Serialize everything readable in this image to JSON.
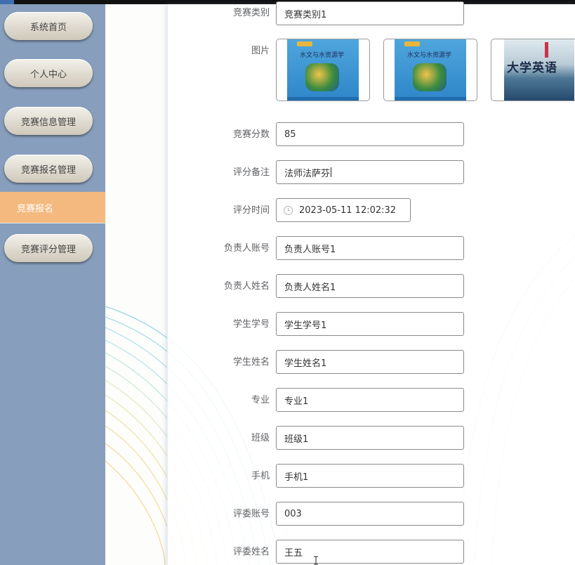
{
  "sidebar": {
    "items": [
      {
        "label": "系统首页"
      },
      {
        "label": "个人中心"
      },
      {
        "label": "竞赛信息管理"
      },
      {
        "label": "竞赛报名管理"
      },
      {
        "label": "竞赛报名",
        "active": true
      },
      {
        "label": "竞赛评分管理"
      }
    ],
    "active_color": "#f4b97e",
    "bg_color": "#879fbd"
  },
  "form": {
    "fields": {
      "category": {
        "label": "竞赛类别",
        "value": "竞赛类别1"
      },
      "image": {
        "label": "图片"
      },
      "score": {
        "label": "竞赛分数",
        "value": "85"
      },
      "remark": {
        "label": "评分备注",
        "value": "法师法萨芬"
      },
      "score_time": {
        "label": "评分时间",
        "value": "2023-05-11 12:02:32",
        "icon": "clock-icon"
      },
      "leader_account": {
        "label": "负责人账号",
        "value": "负责人账号1"
      },
      "leader_name": {
        "label": "负责人姓名",
        "value": "负责人姓名1"
      },
      "student_no": {
        "label": "学生学号",
        "value": "学生学号1"
      },
      "student_name": {
        "label": "学生姓名",
        "value": "学生姓名1"
      },
      "major": {
        "label": "专业",
        "value": "专业1"
      },
      "class": {
        "label": "班级",
        "value": "班级1"
      },
      "phone": {
        "label": "手机",
        "value": "手机1"
      },
      "judge_account": {
        "label": "评委账号",
        "value": "003"
      },
      "judge_name": {
        "label": "评委姓名",
        "value": "王五"
      }
    },
    "images": {
      "book1_title": "水文与水资源学",
      "book2_title": "水文与水资源学",
      "book3_title": "大学英语"
    }
  }
}
